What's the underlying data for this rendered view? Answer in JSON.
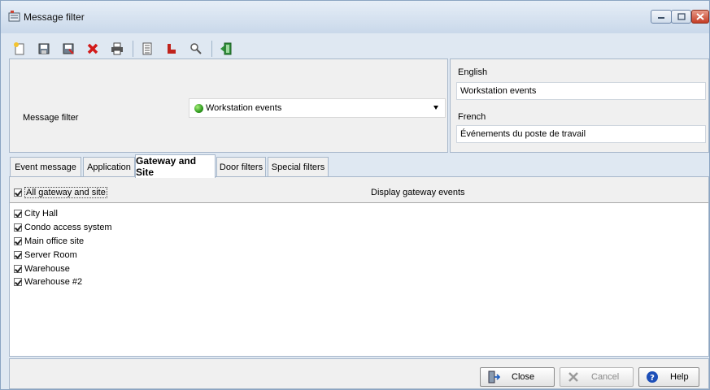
{
  "window": {
    "title": "Message filter"
  },
  "toolbar": {
    "buttons": [
      {
        "name": "new-icon"
      },
      {
        "name": "save-icon"
      },
      {
        "name": "save-as-icon"
      },
      {
        "name": "delete-icon"
      },
      {
        "name": "print-icon"
      },
      {
        "name": "list-icon"
      },
      {
        "name": "links-icon"
      },
      {
        "name": "search-icon"
      },
      {
        "name": "exit-icon"
      }
    ]
  },
  "filter": {
    "label": "Message filter",
    "selected": "Workstation events"
  },
  "languages": {
    "english_label": "English",
    "english_value": "Workstation events",
    "french_label": "French",
    "french_value": "Événements du poste de travail"
  },
  "tabs": [
    {
      "label": "Event message"
    },
    {
      "label": "Application"
    },
    {
      "label": "Gateway and Site",
      "active": true
    },
    {
      "label": "Door filters"
    },
    {
      "label": "Special filters"
    }
  ],
  "gateway": {
    "all_label": "All gateway and site",
    "all_checked": true,
    "display_label": "Display gateway events",
    "sites": [
      {
        "name": "City Hall",
        "checked": true
      },
      {
        "name": "Condo access system",
        "checked": true
      },
      {
        "name": "Main office site",
        "checked": true
      },
      {
        "name": "Server Room",
        "checked": true
      },
      {
        "name": "Warehouse",
        "checked": true
      },
      {
        "name": "Warehouse #2",
        "checked": true
      }
    ]
  },
  "buttons": {
    "close": "Close",
    "cancel": "Cancel",
    "help": "Help"
  }
}
